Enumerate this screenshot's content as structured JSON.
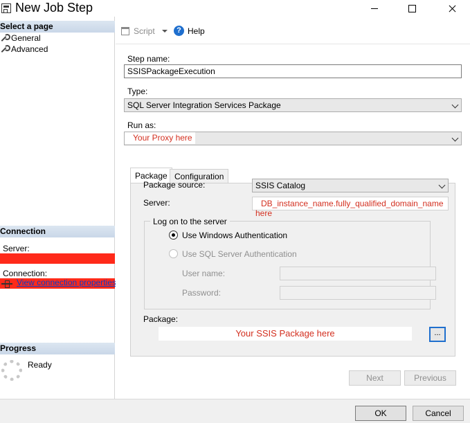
{
  "window": {
    "title": "New Job Step"
  },
  "left_panel": {
    "select_page_header": "Select a page",
    "pages": [
      {
        "label": "General"
      },
      {
        "label": "Advanced"
      }
    ],
    "connection_header": "Connection",
    "server_label": "Server:",
    "connection_label": "Connection:",
    "view_connection_link": "View connection properties",
    "progress_header": "Progress",
    "progress_status": "Ready"
  },
  "toolbar": {
    "script_label": "Script",
    "help_label": "Help"
  },
  "form": {
    "step_name_label": "Step name:",
    "step_name_value": "SSISPackageExecution",
    "type_label": "Type:",
    "type_value": "SQL Server Integration Services Package",
    "run_as_label": "Run as:",
    "run_as_overlay": "Your Proxy here"
  },
  "tabs": [
    {
      "label": "Package",
      "active": true
    },
    {
      "label": "Configuration",
      "active": false
    }
  ],
  "package_tab": {
    "package_source_label": "Package source:",
    "package_source_value": "SSIS Catalog",
    "server_label": "Server:",
    "server_overlay": "DB_instance_name.fully_qualified_domain_name here",
    "logon_legend": "Log on to the server",
    "windows_auth_label": "Use Windows Authentication",
    "sql_auth_label": "Use SQL Server Authentication",
    "username_label": "User name:",
    "password_label": "Password:",
    "package_label": "Package:",
    "package_overlay": "Your SSIS Package here",
    "browse_label": "..."
  },
  "nav_buttons": {
    "next": "Next",
    "previous": "Previous"
  },
  "dialog_buttons": {
    "ok": "OK",
    "cancel": "Cancel"
  },
  "colors": {
    "redaction": "#ff2a1a",
    "overlay_text": "#d32f1f",
    "link": "#0a3cc6",
    "accent": "#1f6fce"
  }
}
